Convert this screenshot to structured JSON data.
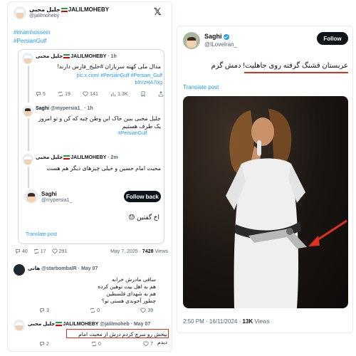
{
  "left": {
    "header": {
      "name": "JALILMOHEBY",
      "name_fa": "جلیل محبی",
      "handle": "@jalilmoheby",
      "x_logo": "𝕏"
    },
    "hashtags": [
      "#imamhossein",
      "#PersianGulf"
    ],
    "quote": {
      "tweet1": {
        "name": "JALILMOHEBY",
        "name_fa": "جلیل محبی",
        "time": "· 1h",
        "text": "مدال ملی کهنه سربازان #خلیج_فارس دارند!",
        "links": "pic.x.com/ #PersianGulf #Persian_Gulf b9YzHA7lxg",
        "stats": {
          "replies": "5",
          "reposts": "19",
          "likes": "141",
          "views": "1.3K"
        }
      },
      "tweet2": {
        "name": "Saghi",
        "handle": "@mypersia1_",
        "time": "· 1h",
        "text": "جلیل محبی ببین خاک این وطن چیه که کن و تو امروز یک طرف هستیم",
        "hashtag": "#PersianGulf"
      },
      "tweet3": {
        "name": "JALILMOHEBY",
        "name_fa": "جلیل محبی",
        "time": "· 2m",
        "text": "محبت امام حسین و خیلی چیزهای دیگر هم هست"
      },
      "tweet4": {
        "name": "Saghi",
        "handle": "@mypersia1_",
        "follow_back": "Follow back",
        "text": "اخ گفتین 😓",
        "translate": "Translate post"
      }
    },
    "main_stats": {
      "replies": "40",
      "reposts": "17",
      "likes": "291",
      "date": "May 7, 2025 ·",
      "views": "7428",
      "views_label": "Views"
    },
    "reply1": {
      "name": "هانی",
      "handle": "@starbombalR · May 07",
      "lines": [
        "ساقی مادرش خرابه",
        "هم به اهل بیت توهین کرده",
        "هم به شهدای فلسطین",
        "چطور آخوندی هستی تو؟"
      ],
      "stats": {
        "replies": "3",
        "reposts": "0",
        "likes": "39"
      }
    },
    "reply2": {
      "name": "JALILMOHEBY",
      "name_fa": "جلیل محبی",
      "handle": "@jalilmoheb · May 07",
      "text": "بیخش رو سرچ کردم درش از محبت امام دیدم",
      "stats": {
        "replies": "2",
        "reposts": "0",
        "likes": "7"
      }
    }
  },
  "right": {
    "header": {
      "name": "Saghi",
      "handle": "@ILoveIran_",
      "follow": "Follow"
    },
    "text": "عربستان قشنگ گرفته روی جاهلیت! دمش گرم",
    "translate": "Translate post",
    "footer": {
      "time": "2:50 PM · 16/11/2024 ·",
      "views": "13K",
      "views_label": "Views"
    }
  },
  "colors": {
    "accent": "#1d9bf0",
    "highlight": "#e0301e",
    "text": "#0f1419",
    "muted": "#536471"
  }
}
